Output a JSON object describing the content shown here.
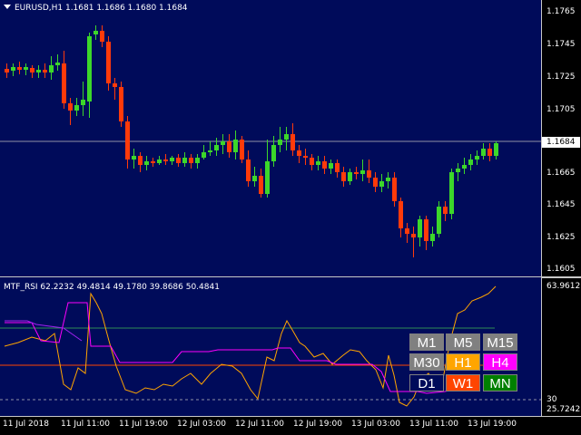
{
  "main_chart": {
    "header": "EURUSD,H1  1.1681 1.1686 1.1680 1.1684",
    "current_price": "1.1684",
    "price_ticks": [
      "1.1765",
      "1.1745",
      "1.1725",
      "1.1705",
      "1.1665",
      "1.1645",
      "1.1625",
      "1.1605"
    ],
    "colors": {
      "bull": "#3cd72a",
      "bear": "#ff3a0a",
      "background": "#000b5a",
      "price_line": "#c0c0c0"
    }
  },
  "indicator": {
    "header": "MTF_RSI 62.2232 49.4814 49.1780 39.8686 50.4841",
    "max_label": "63.9612",
    "level_label": "30",
    "min_label": "25.7242"
  },
  "time_axis": [
    "11 Jul 2018",
    "11 Jul 11:00",
    "11 Jul 19:00",
    "12 Jul 03:00",
    "12 Jul 11:00",
    "12 Jul 19:00",
    "13 Jul 03:00",
    "13 Jul 11:00",
    "13 Jul 19:00"
  ],
  "timeframes": [
    {
      "label": "M1",
      "bg": "#808080",
      "fg": "#ffffff"
    },
    {
      "label": "M5",
      "bg": "#808080",
      "fg": "#ffffff"
    },
    {
      "label": "M15",
      "bg": "#808080",
      "fg": "#ffffff"
    },
    {
      "label": "M30",
      "bg": "#808080",
      "fg": "#ffffff"
    },
    {
      "label": "H1",
      "bg": "#ffa500",
      "fg": "#ffffff"
    },
    {
      "label": "H4",
      "bg": "#ff00ff",
      "fg": "#ffffff"
    },
    {
      "label": "D1",
      "bg": "#000b5a",
      "fg": "#ffffff"
    },
    {
      "label": "W1",
      "bg": "#ff4500",
      "fg": "#ffffff"
    },
    {
      "label": "MN",
      "bg": "#008000",
      "fg": "#ffffff"
    }
  ]
}
